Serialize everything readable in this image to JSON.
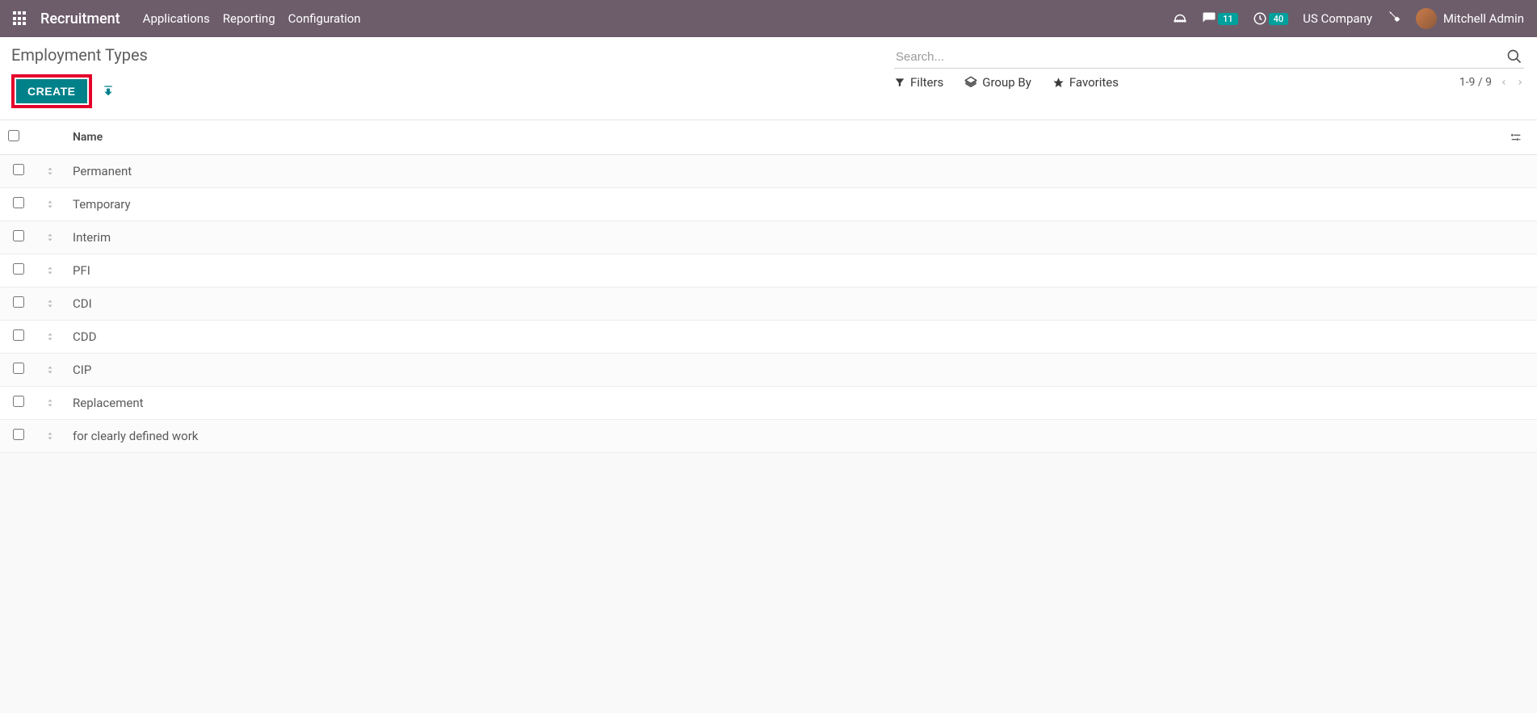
{
  "navbar": {
    "brand": "Recruitment",
    "links": [
      "Applications",
      "Reporting",
      "Configuration"
    ],
    "messages_badge": "11",
    "activities_badge": "40",
    "company": "US Company",
    "user": "Mitchell Admin"
  },
  "breadcrumb": "Employment Types",
  "buttons": {
    "create": "CREATE"
  },
  "search": {
    "placeholder": "Search..."
  },
  "filters": {
    "filters": "Filters",
    "group_by": "Group By",
    "favorites": "Favorites"
  },
  "pager": {
    "range": "1-9 / 9"
  },
  "table": {
    "columns": {
      "name": "Name"
    },
    "rows": [
      {
        "name": "Permanent"
      },
      {
        "name": "Temporary"
      },
      {
        "name": "Interim"
      },
      {
        "name": "PFI"
      },
      {
        "name": "CDI"
      },
      {
        "name": "CDD"
      },
      {
        "name": "CIP"
      },
      {
        "name": "Replacement"
      },
      {
        "name": "for clearly defined work"
      }
    ]
  }
}
